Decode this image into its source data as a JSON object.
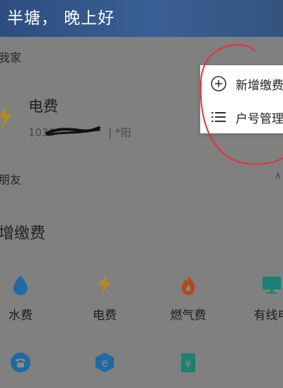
{
  "header": {
    "greeting": "半塘， 晚上好"
  },
  "home_section": {
    "label": "我家"
  },
  "bill": {
    "title": "电费",
    "account_visible": "1030",
    "separator": "|",
    "name": "*阳"
  },
  "friends_section": {
    "label": "朋友"
  },
  "quick_pay": {
    "title": "增缴费",
    "services_row1": [
      {
        "label": "水费",
        "icon": "water-drop-icon",
        "color": "#2d86c8"
      },
      {
        "label": "电费",
        "icon": "lightning-icon",
        "color": "#d79a10"
      },
      {
        "label": "燃气费",
        "icon": "flame-icon",
        "color": "#d65a2b"
      },
      {
        "label": "有线电",
        "icon": "tv-icon",
        "color": "#24a596"
      }
    ],
    "services_row2": [
      {
        "label": "",
        "icon": "telephone-icon",
        "color": "#2d86c8"
      },
      {
        "label": "",
        "icon": "broadband-e-icon",
        "color": "#2d86c8"
      },
      {
        "label": "",
        "icon": "building-yen-icon",
        "color": "#24a596"
      }
    ]
  },
  "popup_menu": {
    "items": [
      {
        "label": "新增缴费",
        "icon": "plus-circle-icon"
      },
      {
        "label": "户号管理",
        "icon": "list-icon"
      }
    ]
  },
  "colors": {
    "banner": "#34547f",
    "overlay": "#808080",
    "annotation": "#e8303a"
  }
}
